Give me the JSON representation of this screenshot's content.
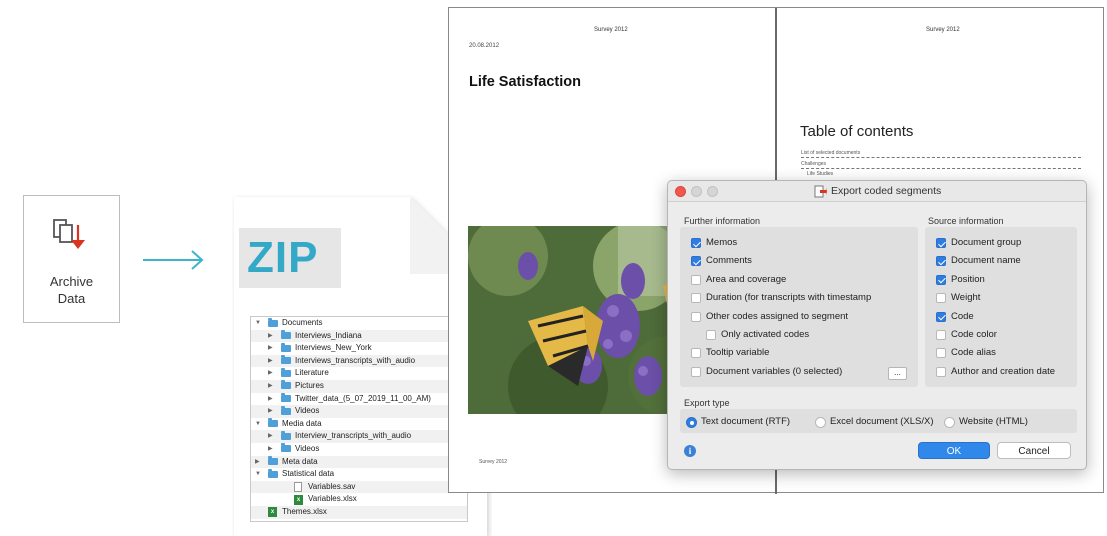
{
  "archive": {
    "label_line1": "Archive",
    "label_line2": "Data",
    "icon": "archive-download-icon",
    "accent": "#d9341f"
  },
  "zip": {
    "label": "ZIP",
    "color": "#33a9c7",
    "tree": [
      {
        "name": "Documents",
        "level": 0,
        "kind": "folder",
        "toggle": "open"
      },
      {
        "name": "Interviews_Indiana",
        "level": 1,
        "kind": "folder",
        "toggle": "closed"
      },
      {
        "name": "Interviews_New_York",
        "level": 1,
        "kind": "folder",
        "toggle": "closed"
      },
      {
        "name": "Interviews_transcripts_with_audio",
        "level": 1,
        "kind": "folder",
        "toggle": "closed"
      },
      {
        "name": "Literature",
        "level": 1,
        "kind": "folder",
        "toggle": "closed"
      },
      {
        "name": "Pictures",
        "level": 1,
        "kind": "folder",
        "toggle": "closed"
      },
      {
        "name": "Twitter_data_(5_07_2019_11_00_AM)",
        "level": 1,
        "kind": "folder",
        "toggle": "closed"
      },
      {
        "name": "Videos",
        "level": 1,
        "kind": "folder",
        "toggle": "closed"
      },
      {
        "name": "Media data",
        "level": 0,
        "kind": "folder",
        "toggle": "open"
      },
      {
        "name": "Interview_transcripts_with_audio",
        "level": 1,
        "kind": "folder",
        "toggle": "closed"
      },
      {
        "name": "Videos",
        "level": 1,
        "kind": "folder",
        "toggle": "closed"
      },
      {
        "name": "Meta data",
        "level": 0,
        "kind": "folder",
        "toggle": "closed"
      },
      {
        "name": "Statistical data",
        "level": 0,
        "kind": "folder",
        "toggle": "open"
      },
      {
        "name": "Variables.sav",
        "level": 2,
        "kind": "file"
      },
      {
        "name": "Variables.xlsx",
        "level": 2,
        "kind": "xls"
      },
      {
        "name": "Themes.xlsx",
        "level": 0,
        "kind": "xls"
      }
    ]
  },
  "report": {
    "header_left": "Survey 2012",
    "header_right": "Survey 2012",
    "date": "20.08.2012",
    "title": "Life Satisfaction",
    "toc_title": "Table of contents",
    "toc_entries": [
      "List of selected documents",
      "Challenges",
      "Life Studies",
      "Life Studies"
    ],
    "footer": "Survey 2012"
  },
  "dialog": {
    "title": "Export coded segments",
    "further_label": "Further information",
    "source_label": "Source information",
    "further": [
      {
        "label": "Memos",
        "checked": true
      },
      {
        "label": "Comments",
        "checked": true
      },
      {
        "label": "Area and coverage",
        "checked": false
      },
      {
        "label": "Duration (for transcripts with timestamp",
        "checked": false
      },
      {
        "label": "Other codes assigned to segment",
        "checked": false
      },
      {
        "label": "Only activated codes",
        "checked": false
      },
      {
        "label": "Tooltip variable",
        "checked": false
      },
      {
        "label": "Document variables (0 selected)",
        "checked": false
      }
    ],
    "ellipsis": "...",
    "source": [
      {
        "label": "Document group",
        "checked": true
      },
      {
        "label": "Document name",
        "checked": true
      },
      {
        "label": "Position",
        "checked": true
      },
      {
        "label": "Weight",
        "checked": false
      },
      {
        "label": "Code",
        "checked": true
      },
      {
        "label": "Code color",
        "checked": false
      },
      {
        "label": "Code alias",
        "checked": false
      },
      {
        "label": "Author and creation date",
        "checked": false
      }
    ],
    "export_type_label": "Export type",
    "export_types": [
      {
        "label": "Text document (RTF)",
        "selected": true
      },
      {
        "label": "Excel document (XLS/X)",
        "selected": false
      },
      {
        "label": "Website (HTML)",
        "selected": false
      }
    ],
    "ok": "OK",
    "cancel": "Cancel",
    "accent": "#2f88ea"
  }
}
